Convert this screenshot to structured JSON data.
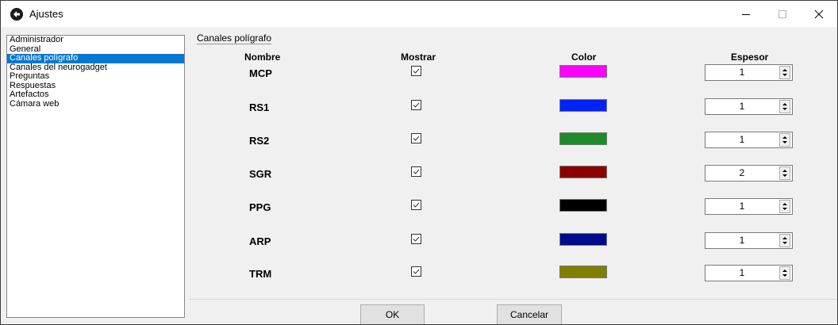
{
  "window": {
    "title": "Ajustes",
    "minimize_glyph": "−",
    "maximize_glyph": "☐",
    "close_glyph": "✕"
  },
  "nav": {
    "items": [
      {
        "label": "Administrador",
        "selected": false
      },
      {
        "label": "General",
        "selected": false
      },
      {
        "label": "Canales polígrafo",
        "selected": true
      },
      {
        "label": "Canales del neurogadget",
        "selected": false
      },
      {
        "label": "Preguntas",
        "selected": false
      },
      {
        "label": "Respuestas",
        "selected": false
      },
      {
        "label": "Artefactos",
        "selected": false
      },
      {
        "label": "Cámara web",
        "selected": false
      }
    ]
  },
  "panel": {
    "group_title": "Canales polígrafo",
    "headers": {
      "name": "Nombre",
      "show": "Mostrar",
      "color": "Color",
      "thickness": "Espesor"
    },
    "channels": [
      {
        "name": "MCP",
        "show": true,
        "color": "#ff00ff",
        "thickness": "1"
      },
      {
        "name": "RS1",
        "show": true,
        "color": "#0022ff",
        "thickness": "1"
      },
      {
        "name": "RS2",
        "show": true,
        "color": "#1f8a2a",
        "thickness": "1"
      },
      {
        "name": "SGR",
        "show": true,
        "color": "#8b0000",
        "thickness": "2"
      },
      {
        "name": "PPG",
        "show": true,
        "color": "#000000",
        "thickness": "1"
      },
      {
        "name": "ARP",
        "show": true,
        "color": "#000b8f",
        "thickness": "1"
      },
      {
        "name": "TRM",
        "show": true,
        "color": "#808000",
        "thickness": "1"
      }
    ]
  },
  "buttons": {
    "ok": "OK",
    "cancel": "Cancelar"
  }
}
